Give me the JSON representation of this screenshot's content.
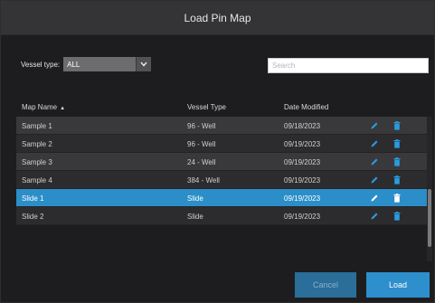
{
  "dialog": {
    "title": "Load Pin Map"
  },
  "filter": {
    "vessel_type_label": "Vessel type:",
    "vessel_type_value": "ALL",
    "search_placeholder": "Search"
  },
  "table": {
    "columns": [
      "Map Name",
      "Vessel Type",
      "Date Modified"
    ],
    "sort_column": "Map Name",
    "sort_direction": "ascending",
    "rows": [
      {
        "name": "Sample 1",
        "type": "96 - Well",
        "date": "09/18/2023",
        "selected": false
      },
      {
        "name": "Sample 2",
        "type": "96 - Well",
        "date": "09/19/2023",
        "selected": false
      },
      {
        "name": "Sample 3",
        "type": "24 - Well",
        "date": "09/19/2023",
        "selected": false
      },
      {
        "name": "Sample 4",
        "type": "384 - Well",
        "date": "09/19/2023",
        "selected": false
      },
      {
        "name": "Slide 1",
        "type": "Slide",
        "date": "09/19/2023",
        "selected": true
      },
      {
        "name": "Slide 2",
        "type": "Slide",
        "date": "09/19/2023",
        "selected": false
      }
    ],
    "row_icons": {
      "edit": "pencil-icon",
      "delete": "trash-icon"
    }
  },
  "buttons": {
    "cancel": "Cancel",
    "load": "Load"
  },
  "colors": {
    "accent": "#2d8fcc",
    "selected_row": "#2c8ec9",
    "icon_blue": "#2b9be0",
    "icon_selected": "#ffffff"
  }
}
